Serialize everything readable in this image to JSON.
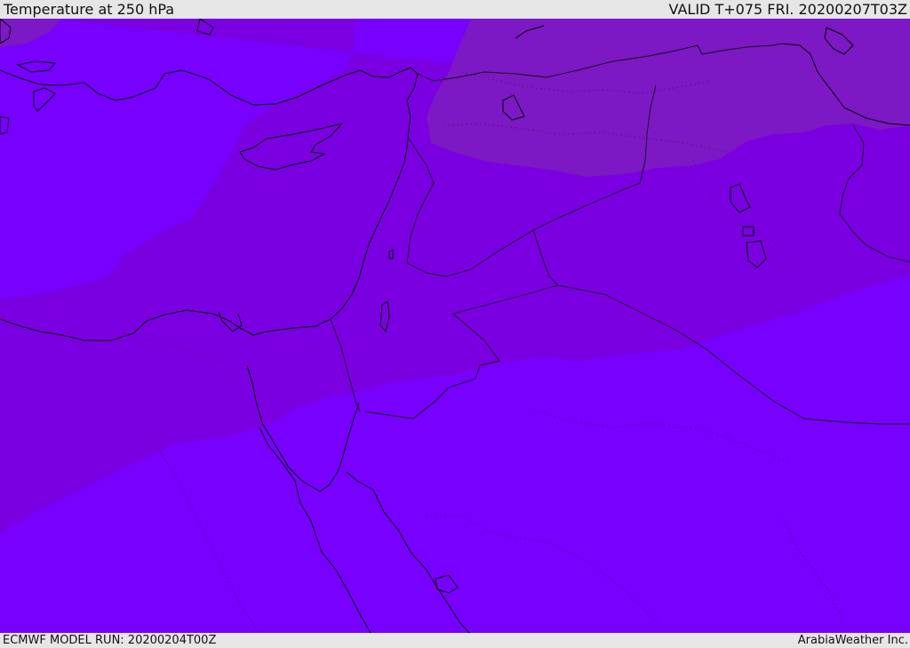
{
  "header": {
    "title": "Temperature at 250 hPa",
    "valid_time": "VALID T+075 FRI. 20200207T03Z"
  },
  "footer": {
    "model_run": "ECMWF MODEL RUN: 20200204T00Z",
    "credit": "ArabiaWeather Inc."
  },
  "map": {
    "colors": {
      "band_warmest": "#7700ff",
      "band_middle": "#7a00e2",
      "band_coldest": "#7c18c4",
      "coastline": "#000000"
    }
  }
}
